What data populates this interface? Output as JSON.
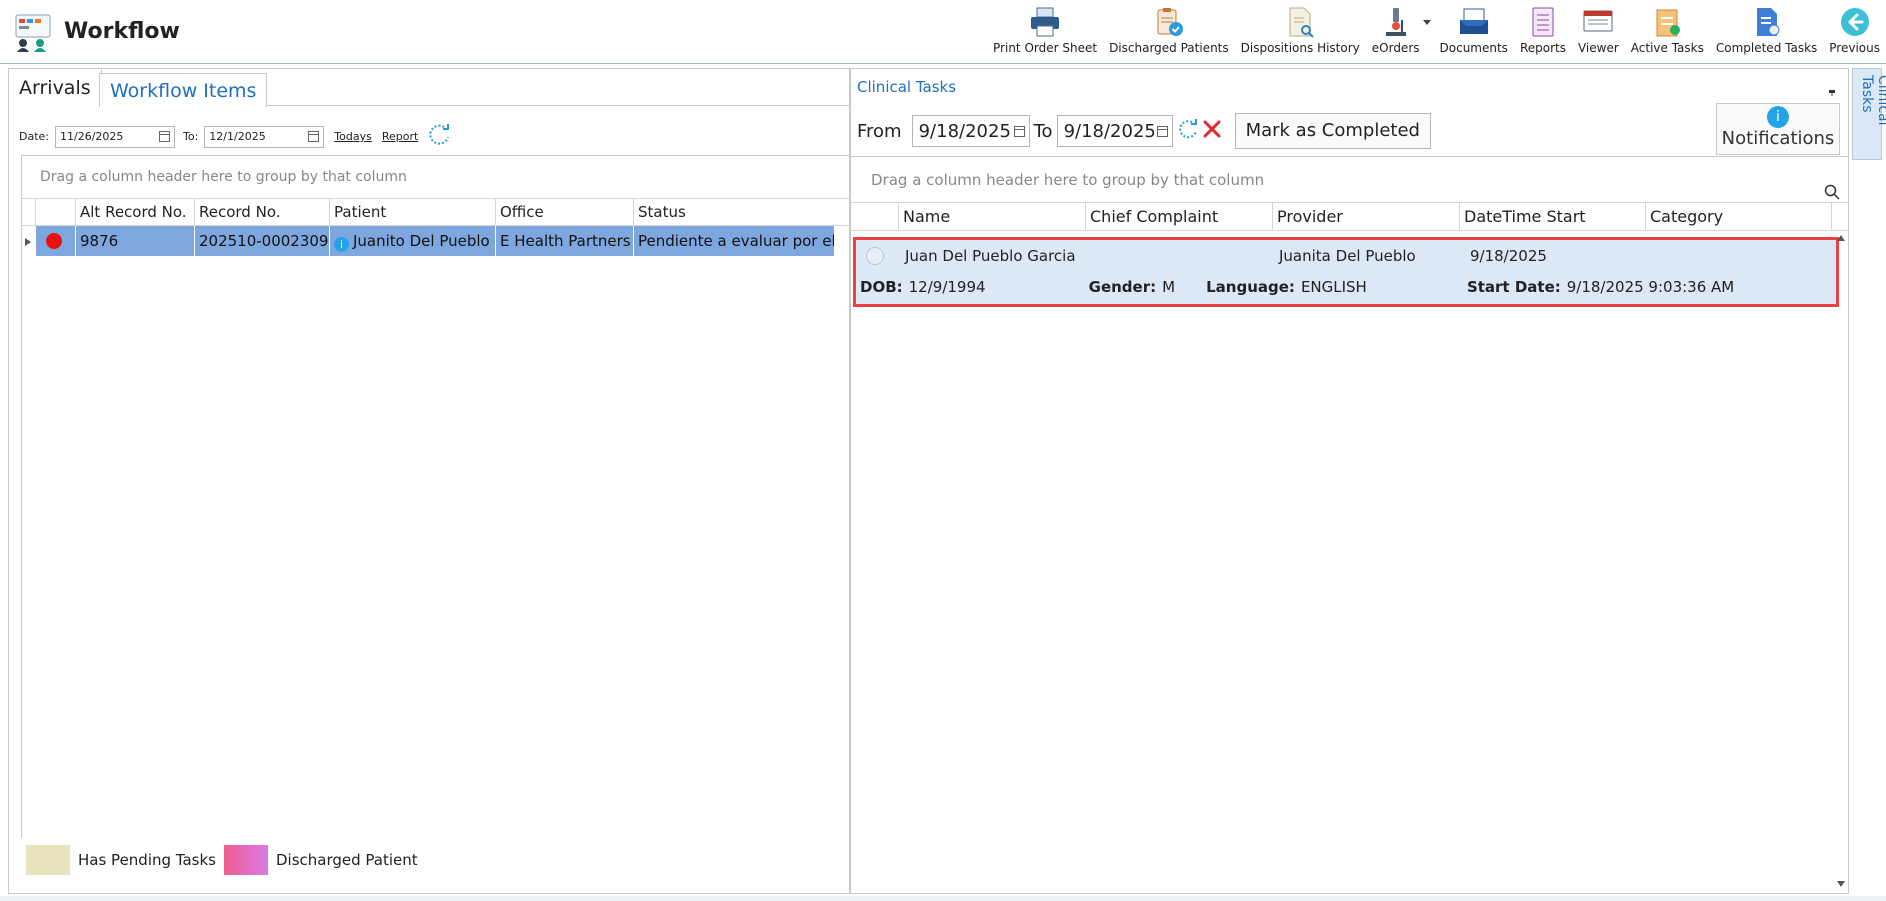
{
  "app": {
    "title": "Workflow"
  },
  "toolbar": [
    {
      "label": "Print Order Sheet",
      "icon": "printer-icon"
    },
    {
      "label": "Discharged Patients",
      "icon": "clipboard-check-icon"
    },
    {
      "label": "Dispositions History",
      "icon": "document-search-icon"
    },
    {
      "label": "eOrders",
      "icon": "microscope-icon"
    },
    {
      "label": "Documents",
      "icon": "folder-tray-icon"
    },
    {
      "label": "Reports",
      "icon": "report-list-icon"
    },
    {
      "label": "Viewer",
      "icon": "viewer-screen-icon"
    },
    {
      "label": "Active Tasks",
      "icon": "active-tasks-icon"
    },
    {
      "label": "Completed Tasks",
      "icon": "completed-tasks-icon"
    },
    {
      "label": "Previous",
      "icon": "back-arrow-icon"
    }
  ],
  "left": {
    "tabs": [
      "Arrivals",
      "Workflow Items"
    ],
    "filter": {
      "date_label": "Date:",
      "date_from": "11/26/2025",
      "to_label": "To:",
      "date_to": "12/1/2025",
      "todays": "Todays",
      "report": "Report"
    },
    "group_hint": "Drag a column header here to group by that column",
    "columns": [
      "Alt Record No.",
      "Record No.",
      "Patient",
      "Office",
      "Status"
    ],
    "rows": [
      {
        "alt_record": "9876",
        "record": "202510-0002309",
        "patient": "Juanito Del Pueblo",
        "office": "E Health Partners",
        "status": "Pendiente a evaluar por el d"
      }
    ],
    "legend": [
      {
        "label": "Has Pending Tasks",
        "color": "#e8e2bd"
      },
      {
        "label": "Discharged Patient",
        "color": "#e96aa2"
      }
    ]
  },
  "right": {
    "title": "Clinical Tasks",
    "from_label": "From",
    "date_from": "9/18/2025",
    "to_label": "To",
    "date_to": "9/18/2025",
    "mark_completed": "Mark as Completed",
    "notifications": "Notifications",
    "group_hint": "Drag a column header here to group by that column",
    "columns": [
      "Name",
      "Chief Complaint",
      "Provider",
      "DateTime Start",
      "Category"
    ],
    "task": {
      "name": "Juan Del Pueblo Garcia",
      "chief_complaint": "",
      "provider": "Juanita Del Pueblo",
      "datetime_start": "9/18/2025",
      "category": "",
      "dob_label": "DOB:",
      "dob": "12/9/1994",
      "gender_label": "Gender:",
      "gender": "M",
      "language_label": "Language:",
      "language": "ENGLISH",
      "start_label": "Start Date:",
      "start": "9/18/2025 9:03:36 AM"
    }
  },
  "side_tab": "Clinical Tasks",
  "colors": {
    "accent": "#1e6fc2",
    "selected_row": "#7ea7e0",
    "task_bg": "#dbe8f6",
    "highlight_border": "#e8413f"
  }
}
